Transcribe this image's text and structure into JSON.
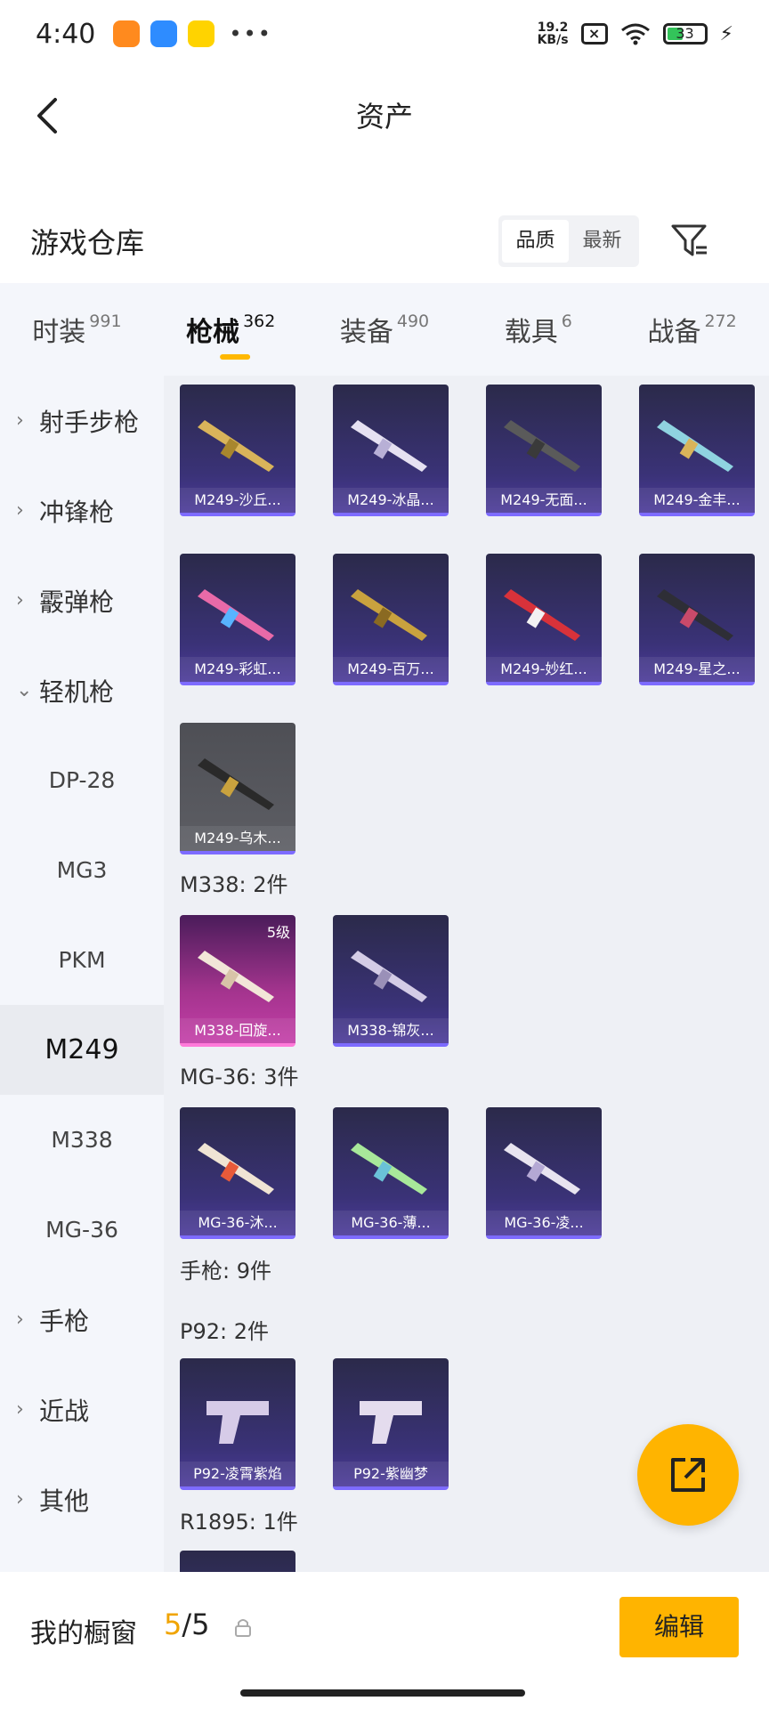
{
  "status_bar": {
    "time": "4:40",
    "net_speed_value": "19.2",
    "net_speed_unit": "KB/s",
    "battery": "33",
    "icons": [
      "orange-app-icon",
      "blue-app-icon",
      "yellow-app-icon",
      "more-dots-icon",
      "sim-x-icon",
      "wifi-icon",
      "battery-icon",
      "charging-icon"
    ]
  },
  "nav": {
    "title": "资产"
  },
  "warehouse": {
    "title": "游戏仓库",
    "sort_options": [
      "品质",
      "最新"
    ]
  },
  "tabs": [
    {
      "label": "时装",
      "count": "991"
    },
    {
      "label": "枪械",
      "count": "362"
    },
    {
      "label": "装备",
      "count": "490"
    },
    {
      "label": "载具",
      "count": "6"
    },
    {
      "label": "战备",
      "count": "272"
    }
  ],
  "sidebar": {
    "categories": [
      "射手步枪",
      "冲锋枪",
      "霰弹枪",
      "轻机枪"
    ],
    "sub_items": [
      "DP-28",
      "MG3",
      "PKM",
      "M249",
      "M338",
      "MG-36"
    ],
    "more_categories": [
      "手枪",
      "近战",
      "其他"
    ]
  },
  "content": {
    "m249_items": [
      "M249-沙丘...",
      "M249-冰晶...",
      "M249-无面...",
      "M249-金丰...",
      "M249-彩虹...",
      "M249-百万...",
      "M249-妙红...",
      "M249-星之...",
      "M249-乌木..."
    ],
    "group_m338": "M338: 2件",
    "m338_items": [
      "M338-回旋...",
      "M338-锦灰..."
    ],
    "m338_level": "5级",
    "group_mg36": "MG-36: 3件",
    "mg36_items": [
      "MG-36-沐...",
      "MG-36-薄...",
      "MG-36-凌..."
    ],
    "group_pistol": "手枪: 9件",
    "group_p92": "P92: 2件",
    "p92_items": [
      "P92-凌霄紫焰",
      "P92-紫幽梦"
    ],
    "group_r1895": "R1895: 1件"
  },
  "bottom": {
    "title": "我的橱窗",
    "current": "5",
    "total": "/5",
    "edit_label": "编辑"
  },
  "colors": {
    "accent": "#ffb400",
    "count_highlight": "#f0a400",
    "card_bg": "#3a3277",
    "sidebar_bg": "#f4f6fb"
  }
}
